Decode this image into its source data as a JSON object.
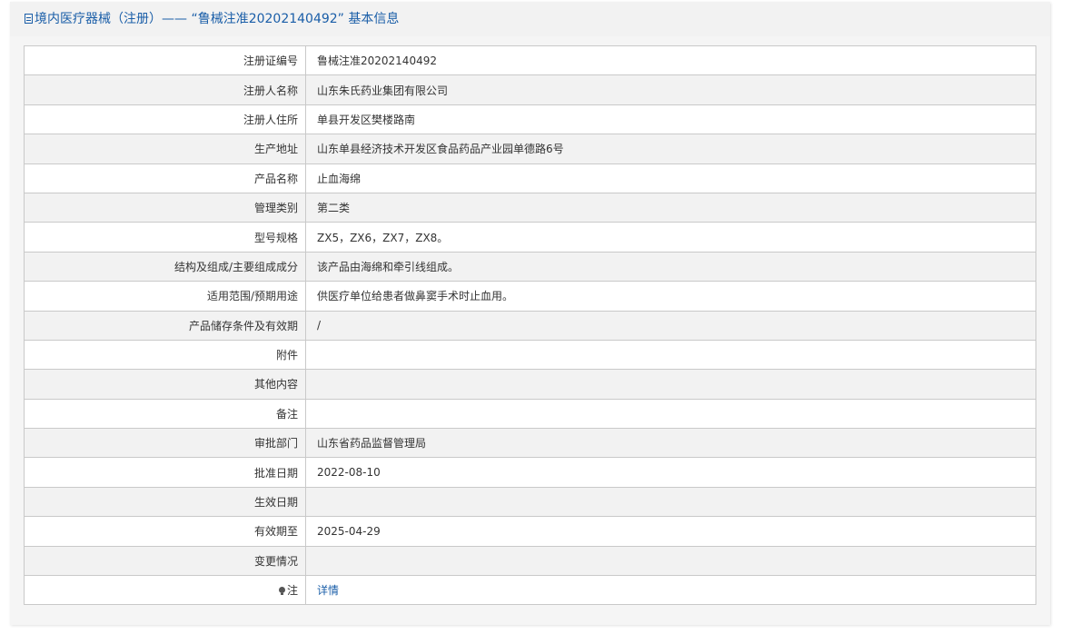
{
  "header": {
    "title": "境内医疗器械（注册）——  “鲁械注准20202140492” 基本信息"
  },
  "rows": [
    {
      "label": "注册证编号",
      "value": "鲁械注准20202140492"
    },
    {
      "label": "注册人名称",
      "value": "山东朱氏药业集团有限公司"
    },
    {
      "label": "注册人住所",
      "value": "单县开发区樊楼路南"
    },
    {
      "label": "生产地址",
      "value": "山东单县经济技术开发区食品药品产业园单德路6号"
    },
    {
      "label": "产品名称",
      "value": "止血海绵"
    },
    {
      "label": "管理类别",
      "value": "第二类"
    },
    {
      "label": "型号规格",
      "value": "ZX5，ZX6，ZX7，ZX8。"
    },
    {
      "label": "结构及组成/主要组成成分",
      "value": "该产品由海绵和牵引线组成。"
    },
    {
      "label": "适用范围/预期用途",
      "value": "供医疗单位给患者做鼻窦手术时止血用。"
    },
    {
      "label": "产品储存条件及有效期",
      "value": "/"
    },
    {
      "label": "附件",
      "value": ""
    },
    {
      "label": "其他内容",
      "value": ""
    },
    {
      "label": "备注",
      "value": ""
    },
    {
      "label": "审批部门",
      "value": "山东省药品监督管理局"
    },
    {
      "label": "批准日期",
      "value": "2022-08-10"
    },
    {
      "label": "生效日期",
      "value": ""
    },
    {
      "label": "有效期至",
      "value": "2025-04-29"
    },
    {
      "label": "变更情况",
      "value": ""
    }
  ],
  "note": {
    "label": "注",
    "link_text": "详情",
    "icon": "lightbulb-icon"
  },
  "colors": {
    "accent": "#1a5ea8",
    "border": "#c9c9c9",
    "stripe": "#f2f2f2"
  }
}
